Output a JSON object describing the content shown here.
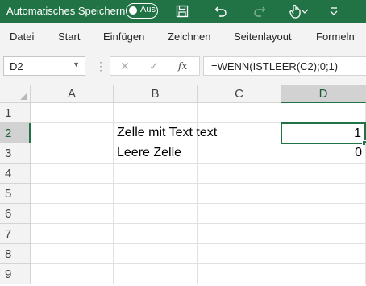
{
  "titlebar": {
    "autosave_label": "Automatisches Speichern",
    "toggle_state": "Aus",
    "icons": [
      "save-icon",
      "undo-icon",
      "redo-icon",
      "touch-mode-icon",
      "customize-quick-access-icon"
    ]
  },
  "ribbon": {
    "tabs": [
      "Datei",
      "Start",
      "Einfügen",
      "Zeichnen",
      "Seitenlayout",
      "Formeln"
    ]
  },
  "formula_bar": {
    "name_box": "D2",
    "cancel_symbol": "✕",
    "enter_symbol": "✓",
    "function_symbol": "fx",
    "formula": "=WENN(ISTLEER(C2);0;1)"
  },
  "sheet": {
    "columns": [
      "A",
      "B",
      "C",
      "D"
    ],
    "rows": [
      "1",
      "2",
      "3",
      "4",
      "5",
      "6",
      "7",
      "8",
      "9"
    ],
    "selected_cell": "D2",
    "cells": {
      "B2": "Zelle mit Text text",
      "D2": "1",
      "B3": "Leere Zelle",
      "D3": "0"
    }
  },
  "colors": {
    "excel_green": "#217346",
    "header_bg": "#f3f3f3",
    "gridline": "#e1e1e1"
  }
}
